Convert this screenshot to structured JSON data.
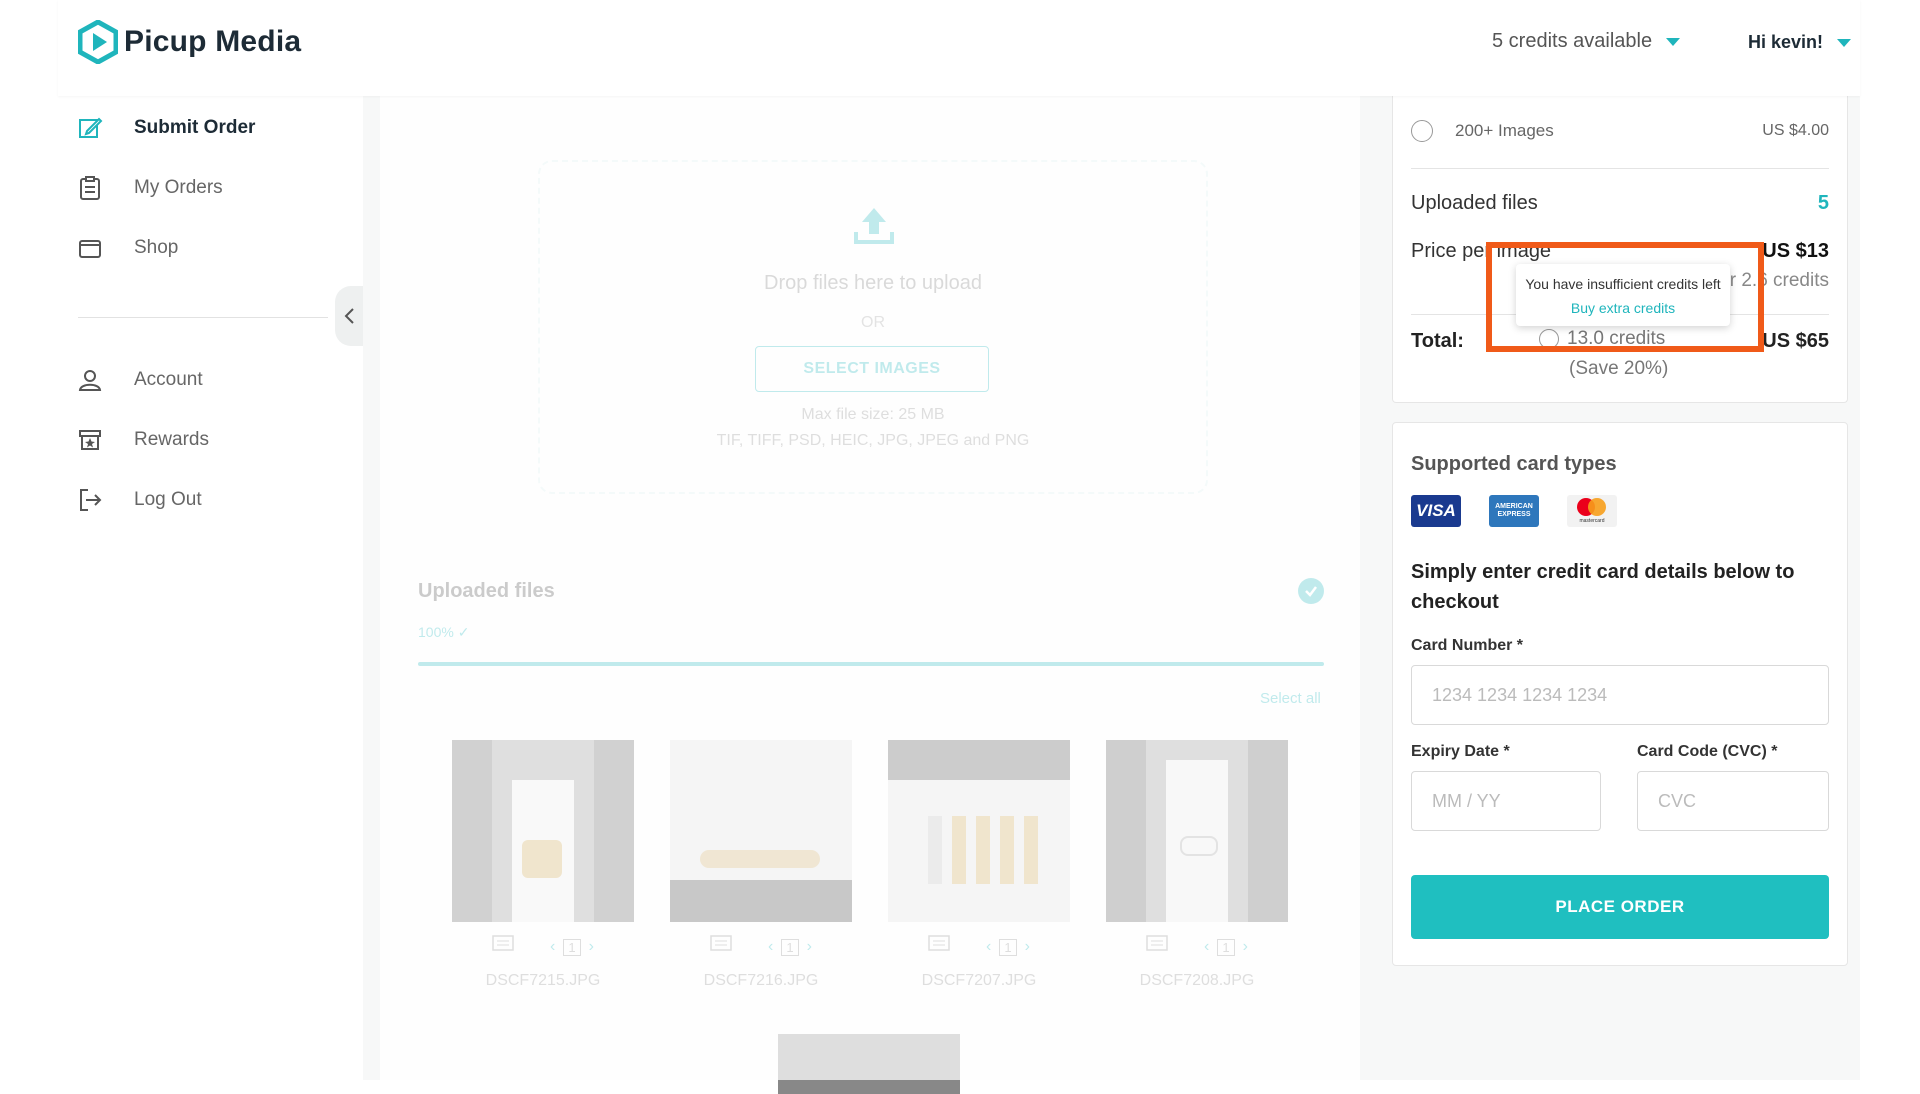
{
  "brand": {
    "name": "Picup Media",
    "accent": "#1fb5bc",
    "highlight": "#f05a19"
  },
  "header": {
    "credits_label": "5 credits available",
    "user_label": "Hi kevin!"
  },
  "sidebar": {
    "items": [
      {
        "label": "Submit Order",
        "icon": "edit-icon"
      },
      {
        "label": "My Orders",
        "icon": "clipboard-icon"
      },
      {
        "label": "Shop",
        "icon": "shop-icon"
      },
      {
        "label": "Account",
        "icon": "user-icon"
      },
      {
        "label": "Rewards",
        "icon": "rewards-icon"
      },
      {
        "label": "Log Out",
        "icon": "logout-icon"
      }
    ]
  },
  "upload": {
    "drop_text": "Drop files here to upload",
    "or_text": "OR",
    "select_button": "SELECT IMAGES",
    "max_size": "Max file size: 25 MB",
    "types": "TIF, TIFF, PSD, HEIC, JPG, JPEG and PNG"
  },
  "uploaded": {
    "title": "Uploaded files",
    "progress_label": "100% ✓",
    "progress": 1.0,
    "select_all": "Select all",
    "files": [
      {
        "name": "DSCF7215.JPG",
        "count": "1"
      },
      {
        "name": "DSCF7216.JPG",
        "count": "1"
      },
      {
        "name": "DSCF7207.JPG",
        "count": "1"
      },
      {
        "name": "DSCF7208.JPG",
        "count": "1"
      }
    ]
  },
  "pricing": {
    "tier_label": "200+ Images",
    "tier_price": "US $4.00",
    "uploaded_files_label": "Uploaded files",
    "uploaded_files_count": "5",
    "price_per_image_label": "Price per image",
    "price_per_image_value": "US $13",
    "price_per_image_sub": "or 2.6 credits",
    "total_label": "Total:",
    "total_value": "US $65",
    "total_credits": "13.0 credits",
    "total_save": "(Save 20%)"
  },
  "tooltip": {
    "message": "You have insufficient credits left",
    "link": "Buy extra credits"
  },
  "checkout": {
    "supported_cards_title": "Supported card types",
    "cards": [
      "VISA",
      "AMERICAN EXPRESS",
      "mastercard"
    ],
    "title": "Simply enter credit card details below to checkout",
    "card_number_label": "Card Number *",
    "card_number_placeholder": "1234 1234 1234 1234",
    "expiry_label": "Expiry Date *",
    "expiry_placeholder": "MM / YY",
    "cvc_label": "Card Code (CVC) *",
    "cvc_placeholder": "CVC",
    "place_order": "PLACE ORDER"
  }
}
